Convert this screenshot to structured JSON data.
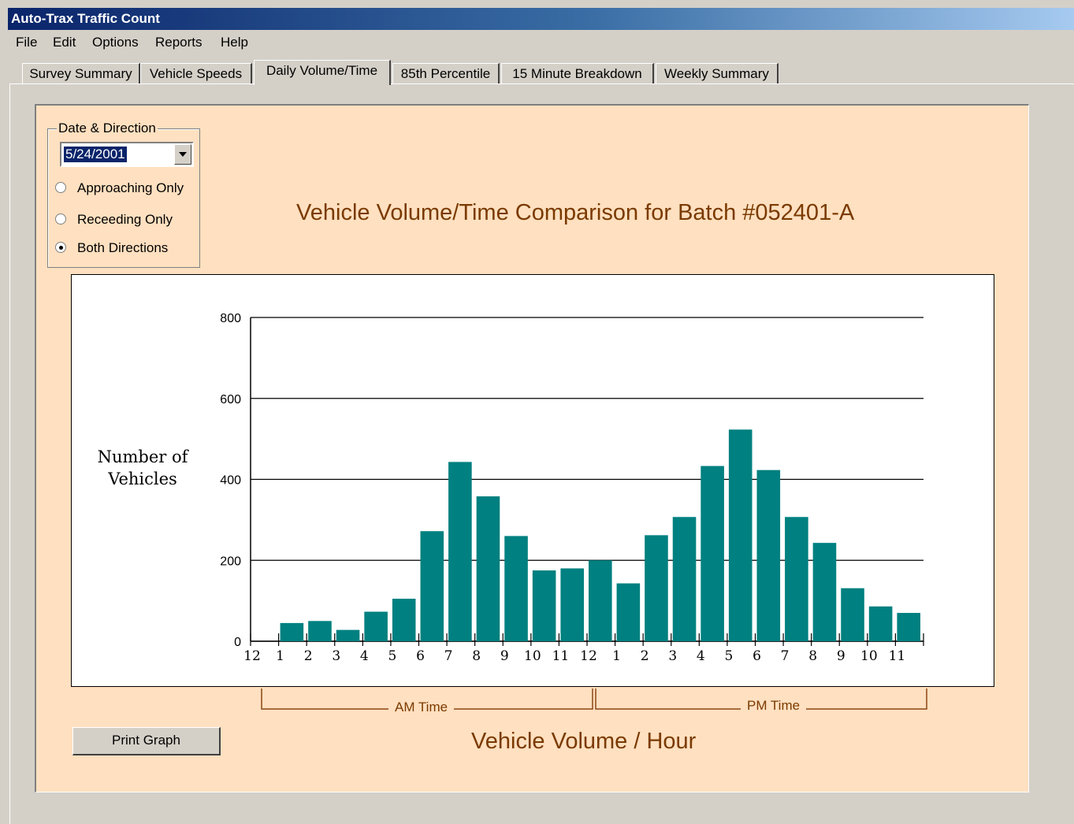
{
  "window": {
    "title": "Auto-Trax Traffic Count"
  },
  "menu": [
    "File",
    "Edit",
    "Options",
    "Reports",
    "Help"
  ],
  "tabs": [
    "Survey Summary",
    "Vehicle Speeds",
    "Daily Volume/Time",
    "85th Percentile",
    "15 Minute Breakdown",
    "Weekly Summary"
  ],
  "active_tab": "Daily Volume/Time",
  "filter": {
    "legend": "Date & Direction",
    "date_value": "5/24/2001",
    "options": [
      "Approaching Only",
      "Receeding Only",
      "Both Directions"
    ],
    "selected": "Both Directions"
  },
  "print_button": "Print Graph",
  "range_labels": {
    "am": "AM Time",
    "pm": "PM Time"
  },
  "colors": {
    "bar": "#008080",
    "panel": "#ffe0c0",
    "title_text": "#7a3a00"
  },
  "chart_data": {
    "type": "bar",
    "title": "Vehicle Volume/Time Comparison for Batch #052401-A",
    "xlabel": "Vehicle Volume / Hour",
    "ylabel": "Number of Vehicles",
    "ylim": [
      0,
      800
    ],
    "yticks": [
      0,
      200,
      400,
      600,
      800
    ],
    "xtick_labels": [
      "12",
      "1",
      "2",
      "3",
      "4",
      "5",
      "6",
      "7",
      "8",
      "9",
      "10",
      "11",
      "12",
      "1",
      "2",
      "3",
      "4",
      "5",
      "6",
      "7",
      "8",
      "9",
      "10",
      "11"
    ],
    "values": [
      45,
      50,
      28,
      73,
      105,
      272,
      443,
      358,
      260,
      175,
      180,
      200,
      143,
      262,
      307,
      433,
      523,
      423,
      307,
      243,
      131,
      86,
      70
    ],
    "grid": true,
    "legend": "none"
  }
}
